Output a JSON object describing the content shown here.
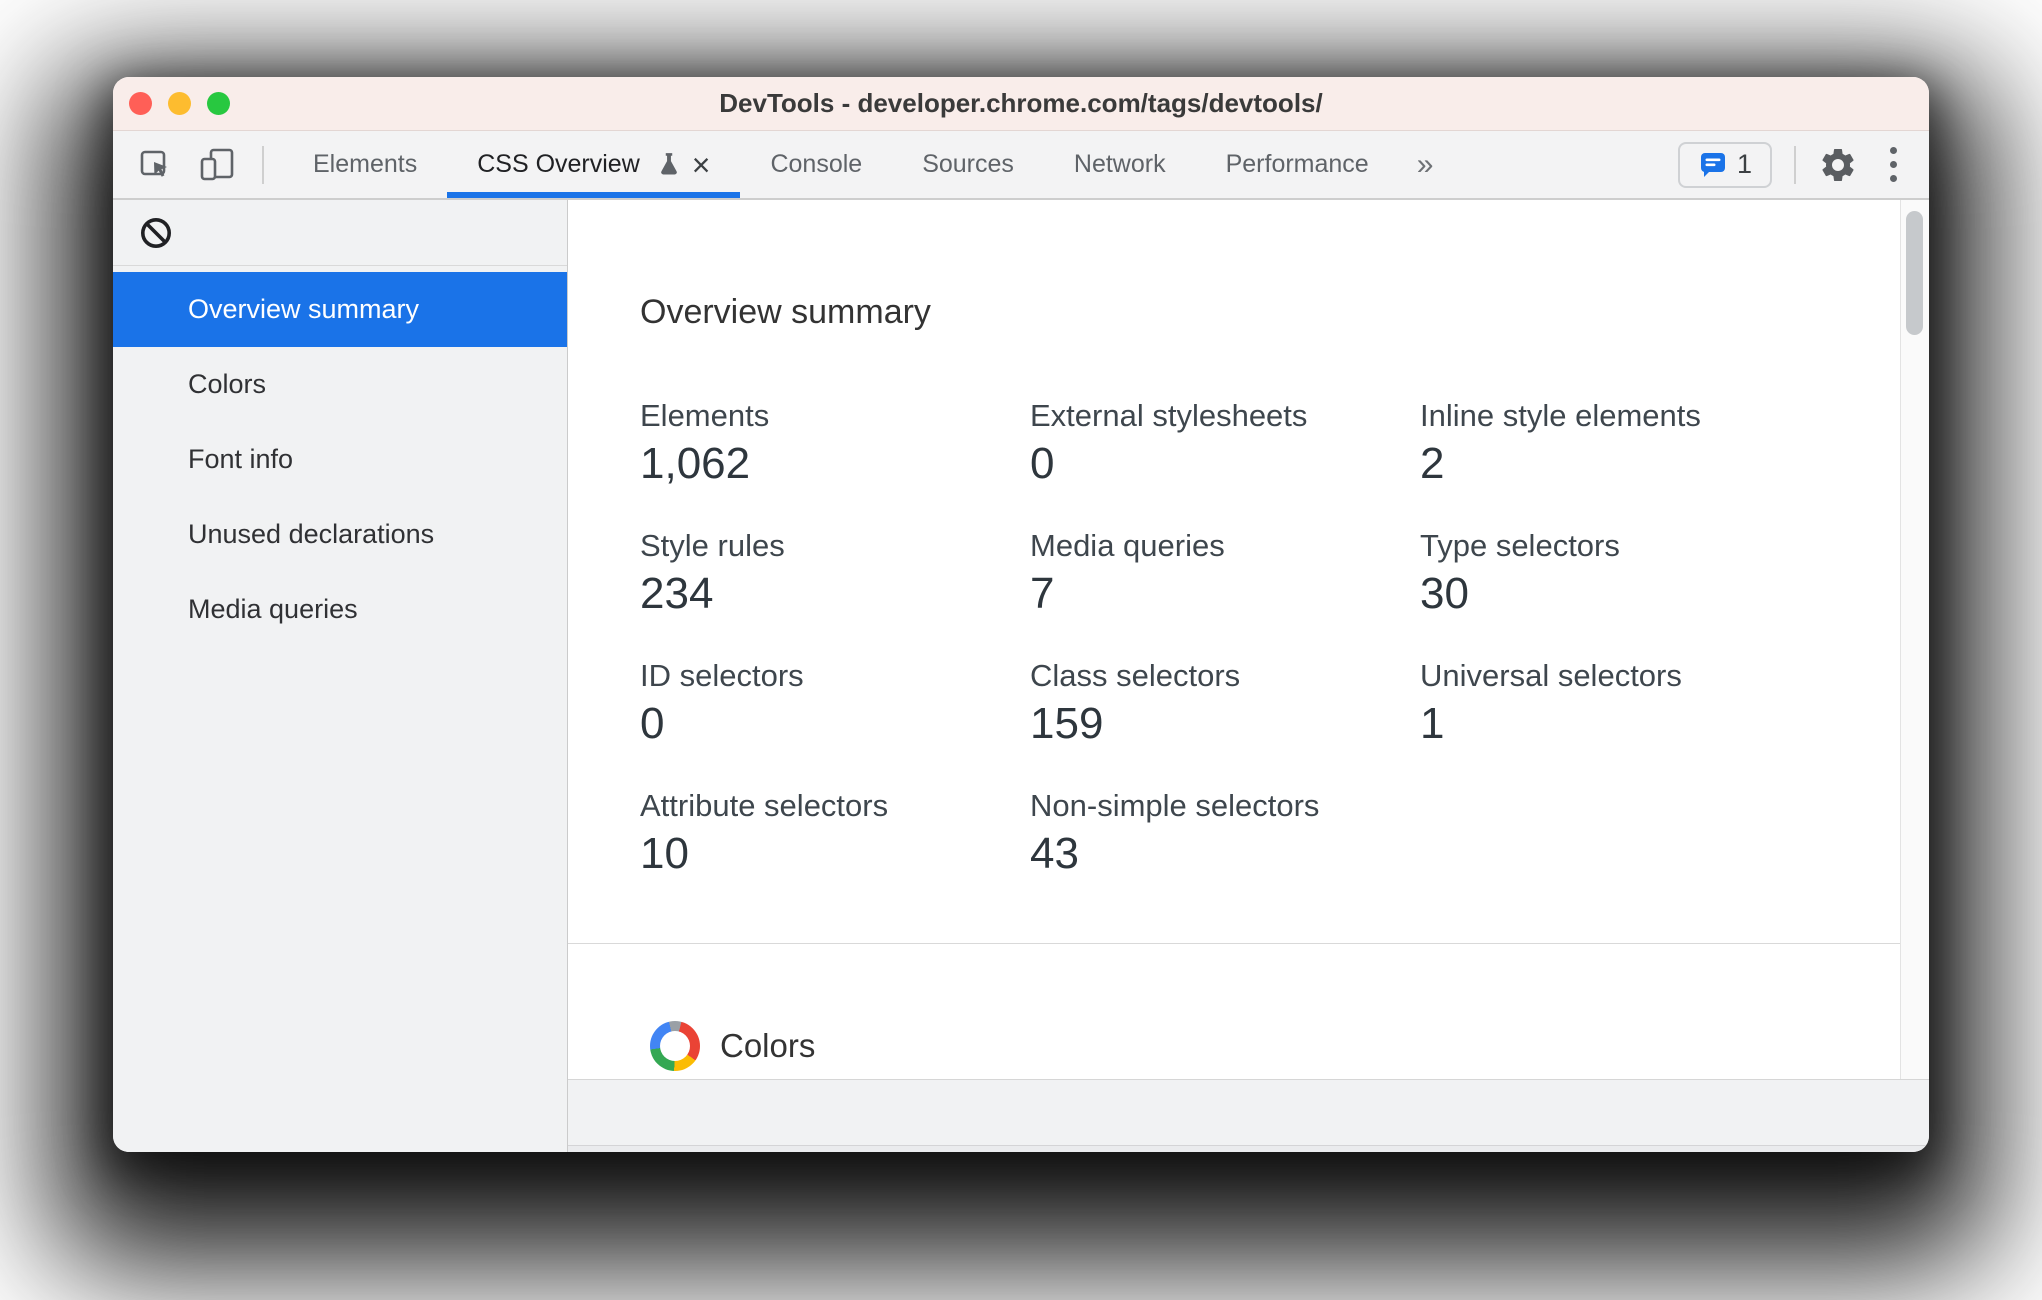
{
  "window": {
    "title": "DevTools - developer.chrome.com/tags/devtools/"
  },
  "toolbar": {
    "tabs": [
      {
        "label": "Elements",
        "active": false
      },
      {
        "label": "CSS Overview",
        "active": true,
        "has_experiment_icon": true,
        "closable": true
      },
      {
        "label": "Console",
        "active": false
      },
      {
        "label": "Sources",
        "active": false
      },
      {
        "label": "Network",
        "active": false
      },
      {
        "label": "Performance",
        "active": false
      }
    ],
    "more_tabs_glyph": "»",
    "close_tab_glyph": "×",
    "issues": {
      "count": "1"
    }
  },
  "sidebar": {
    "items": [
      {
        "label": "Overview summary",
        "selected": true
      },
      {
        "label": "Colors",
        "selected": false
      },
      {
        "label": "Font info",
        "selected": false
      },
      {
        "label": "Unused declarations",
        "selected": false
      },
      {
        "label": "Media queries",
        "selected": false
      }
    ]
  },
  "main": {
    "heading": "Overview summary",
    "stats": [
      {
        "label": "Elements",
        "value": "1,062"
      },
      {
        "label": "External stylesheets",
        "value": "0"
      },
      {
        "label": "Inline style elements",
        "value": "2"
      },
      {
        "label": "Style rules",
        "value": "234"
      },
      {
        "label": "Media queries",
        "value": "7"
      },
      {
        "label": "Type selectors",
        "value": "30"
      },
      {
        "label": "ID selectors",
        "value": "0"
      },
      {
        "label": "Class selectors",
        "value": "159"
      },
      {
        "label": "Universal selectors",
        "value": "1"
      },
      {
        "label": "Attribute selectors",
        "value": "10"
      },
      {
        "label": "Non-simple selectors",
        "value": "43"
      }
    ],
    "colors_section_title": "Colors"
  },
  "colors": {
    "accent_blue": "#1a73e8",
    "titlebar_pink": "#f9edea",
    "toolbar_gray": "#f3f3f4",
    "sidebar_gray": "#f1f2f3",
    "traffic_red": "#ff5f57",
    "traffic_yellow": "#fdbc2f",
    "traffic_green": "#28c840",
    "wheel_red": "#ea4335",
    "wheel_yellow": "#fbbc04",
    "wheel_green": "#34a853",
    "wheel_blue": "#4285f4"
  }
}
